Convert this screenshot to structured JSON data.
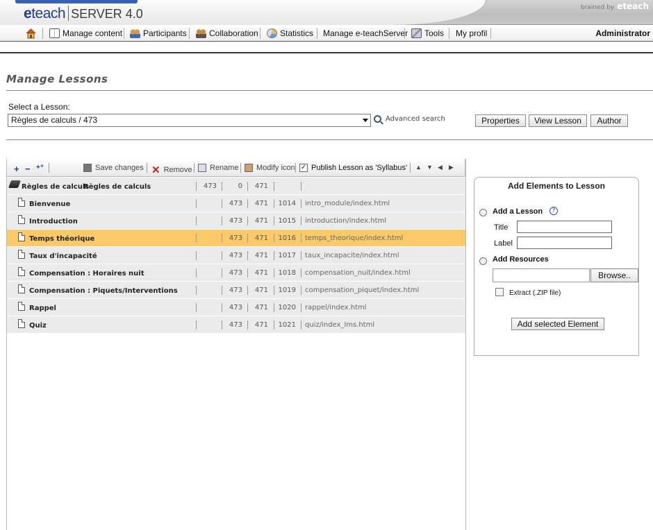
{
  "header": {
    "logo_e": "e",
    "logo_teach": "teach",
    "logo_server": "SERVER 4.0",
    "brained_by": "brained by",
    "brained_brand": "eteach"
  },
  "menu": {
    "items": [
      {
        "label": "Manage content",
        "icon": "book-icon"
      },
      {
        "label": "Participants",
        "icon": "people-icon"
      },
      {
        "label": "Collaboration",
        "icon": "group-icon"
      },
      {
        "label": "Statistics",
        "icon": "chart-icon"
      },
      {
        "label": "Manage e-teachServer",
        "icon": ""
      },
      {
        "label": "Tools",
        "icon": "tools-icon"
      },
      {
        "label": "My profil",
        "icon": ""
      }
    ],
    "user": "Administrator"
  },
  "page": {
    "title": "Manage Lessons",
    "select_label": "Select a Lesson:",
    "selected_lesson": "Règles de calculs / 473",
    "advanced_search": "Advanced search",
    "buttons": {
      "properties": "Properties",
      "view": "View Lesson",
      "author": "Author"
    }
  },
  "toolbar": {
    "save": "Save changes",
    "remove": "Remove",
    "rename": "Rename",
    "modify_icon": "Modify icon",
    "publish": "Publish Lesson as 'Syllabus'"
  },
  "tree": {
    "root": {
      "name": "Règles de calculs",
      "title": "Règles de calculs",
      "c1": "473",
      "c2": "0",
      "c3": "471"
    },
    "rows": [
      {
        "name": "Bienvenue",
        "c1": "473",
        "c2": "471",
        "c3": "1014",
        "path": "intro_module/index.html",
        "selected": false
      },
      {
        "name": "Introduction",
        "c1": "473",
        "c2": "471",
        "c3": "1015",
        "path": "introduction/index.html",
        "selected": false
      },
      {
        "name": "Temps théorique",
        "c1": "473",
        "c2": "471",
        "c3": "1016",
        "path": "temps_theorique/index.html",
        "selected": true
      },
      {
        "name": "Taux d'incapacité",
        "c1": "473",
        "c2": "471",
        "c3": "1017",
        "path": "taux_incapacite/index.html",
        "selected": false
      },
      {
        "name": "Compensation : Horaires nuit",
        "c1": "473",
        "c2": "471",
        "c3": "1018",
        "path": "compensation_nuit/index.html",
        "selected": false
      },
      {
        "name": "Compensation : Piquets/Interventions",
        "c1": "473",
        "c2": "471",
        "c3": "1019",
        "path": "compensation_piquet/index.html",
        "selected": false
      },
      {
        "name": "Rappel",
        "c1": "473",
        "c2": "471",
        "c3": "1020",
        "path": "rappel/index.html",
        "selected": false
      },
      {
        "name": "Quiz",
        "c1": "473",
        "c2": "471",
        "c3": "1021",
        "path": "quiz/index_lms.html",
        "selected": false
      }
    ]
  },
  "panel": {
    "title": "Add Elements to Lesson",
    "add_lesson": "Add a Lesson",
    "title_label": "Title",
    "label_label": "Label",
    "add_resources": "Add Resources",
    "browse": "Browse..",
    "extract": "Extract (.ZIP file)",
    "add_button": "Add selected Element"
  },
  "colors": {
    "selected_row": "#fcca6a",
    "row_bg": "#ebebeb",
    "logo_blue": "#1f3d8c"
  }
}
